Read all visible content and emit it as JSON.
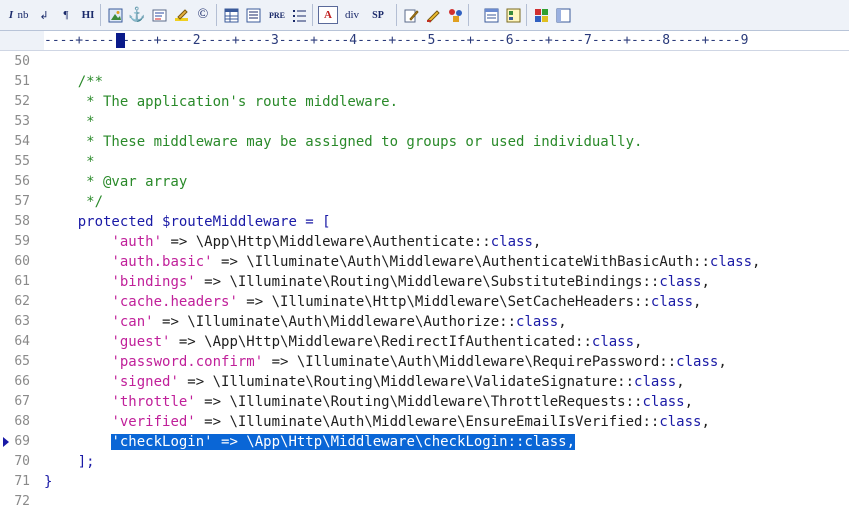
{
  "toolbar": {
    "buttons": [
      {
        "name": "italic-button",
        "label": "I",
        "icon": "italic-icon"
      },
      {
        "name": "nonbreaking-button",
        "label": "nb",
        "icon": "nb-icon"
      },
      {
        "name": "line-break-button",
        "label": "↲",
        "icon": "line-break-icon"
      },
      {
        "name": "paragraph-button",
        "label": "¶",
        "icon": "paragraph-icon"
      },
      {
        "name": "heading-button",
        "label": "HI",
        "icon": "heading-icon"
      },
      {
        "name": "image-button",
        "label": "",
        "icon": "image-icon"
      },
      {
        "name": "anchor-button",
        "label": "⚓",
        "icon": "anchor-icon"
      },
      {
        "name": "link-button",
        "label": "",
        "icon": "link-icon"
      },
      {
        "name": "highlight-button",
        "label": "",
        "icon": "highlight-icon"
      },
      {
        "name": "copyright-button",
        "label": "©",
        "icon": "copyright-icon"
      },
      {
        "name": "table-button",
        "label": "",
        "icon": "table-icon"
      },
      {
        "name": "list-button",
        "label": "",
        "icon": "list-icon"
      },
      {
        "name": "pre-button",
        "label": "PRE",
        "icon": "pre-icon"
      },
      {
        "name": "ordered-list-button",
        "label": "",
        "icon": "ordered-list-icon"
      },
      {
        "name": "font-button",
        "label": "A",
        "icon": "font-icon"
      },
      {
        "name": "div-button",
        "label": "div",
        "icon": "div-icon"
      },
      {
        "name": "span-button",
        "label": "SP",
        "icon": "span-icon"
      },
      {
        "name": "edit-button",
        "label": "",
        "icon": "edit-icon"
      },
      {
        "name": "style-button",
        "label": "",
        "icon": "style-icon"
      },
      {
        "name": "tools-button",
        "label": "",
        "icon": "tools-icon"
      },
      {
        "name": "frame-button",
        "label": "",
        "icon": "frame-icon"
      },
      {
        "name": "form-button",
        "label": "",
        "icon": "form-icon"
      },
      {
        "name": "color-button",
        "label": "",
        "icon": "color-icon"
      },
      {
        "name": "window-button",
        "label": "",
        "icon": "window-icon"
      }
    ]
  },
  "ruler": {
    "text": "----+----1----+----2----+----3----+----4----+----5----+----6----+----7----+----8----+----9"
  },
  "editor": {
    "lines": [
      {
        "n": "50",
        "segments": []
      },
      {
        "n": "51",
        "segments": [
          {
            "t": "    /**",
            "c": "cm"
          }
        ]
      },
      {
        "n": "52",
        "segments": [
          {
            "t": "     * The application's route middleware.",
            "c": "cm"
          }
        ]
      },
      {
        "n": "53",
        "segments": [
          {
            "t": "     *",
            "c": "cm"
          }
        ]
      },
      {
        "n": "54",
        "segments": [
          {
            "t": "     * These middleware may be assigned to groups or used individually.",
            "c": "cm"
          }
        ]
      },
      {
        "n": "55",
        "segments": [
          {
            "t": "     *",
            "c": "cm"
          }
        ]
      },
      {
        "n": "56",
        "segments": [
          {
            "t": "     * @var array",
            "c": "cm"
          }
        ]
      },
      {
        "n": "57",
        "segments": [
          {
            "t": "     */",
            "c": "cm"
          }
        ]
      },
      {
        "n": "58",
        "segments": [
          {
            "t": "    ",
            "c": "ns"
          },
          {
            "t": "protected",
            "c": "kw"
          },
          {
            "t": " ",
            "c": "ns"
          },
          {
            "t": "$routeMiddleware",
            "c": "kw"
          },
          {
            "t": " = [",
            "c": "kw"
          }
        ]
      },
      {
        "n": "59",
        "segments": [
          {
            "t": "        ",
            "c": "ns"
          },
          {
            "t": "'auth'",
            "c": "str"
          },
          {
            "t": " => \\App\\Http\\Middleware\\Authenticate::",
            "c": "ns"
          },
          {
            "t": "class",
            "c": "kw"
          },
          {
            "t": ",",
            "c": "ns"
          }
        ]
      },
      {
        "n": "60",
        "segments": [
          {
            "t": "        ",
            "c": "ns"
          },
          {
            "t": "'auth.basic'",
            "c": "str"
          },
          {
            "t": " => \\Illuminate\\Auth\\Middleware\\AuthenticateWithBasicAuth::",
            "c": "ns"
          },
          {
            "t": "class",
            "c": "kw"
          },
          {
            "t": ",",
            "c": "ns"
          }
        ]
      },
      {
        "n": "61",
        "segments": [
          {
            "t": "        ",
            "c": "ns"
          },
          {
            "t": "'bindings'",
            "c": "str"
          },
          {
            "t": " => \\Illuminate\\Routing\\Middleware\\SubstituteBindings::",
            "c": "ns"
          },
          {
            "t": "class",
            "c": "kw"
          },
          {
            "t": ",",
            "c": "ns"
          }
        ]
      },
      {
        "n": "62",
        "segments": [
          {
            "t": "        ",
            "c": "ns"
          },
          {
            "t": "'cache.headers'",
            "c": "str"
          },
          {
            "t": " => \\Illuminate\\Http\\Middleware\\SetCacheHeaders::",
            "c": "ns"
          },
          {
            "t": "class",
            "c": "kw"
          },
          {
            "t": ",",
            "c": "ns"
          }
        ]
      },
      {
        "n": "63",
        "segments": [
          {
            "t": "        ",
            "c": "ns"
          },
          {
            "t": "'can'",
            "c": "str"
          },
          {
            "t": " => \\Illuminate\\Auth\\Middleware\\Authorize::",
            "c": "ns"
          },
          {
            "t": "class",
            "c": "kw"
          },
          {
            "t": ",",
            "c": "ns"
          }
        ]
      },
      {
        "n": "64",
        "segments": [
          {
            "t": "        ",
            "c": "ns"
          },
          {
            "t": "'guest'",
            "c": "str"
          },
          {
            "t": " => \\App\\Http\\Middleware\\RedirectIfAuthenticated::",
            "c": "ns"
          },
          {
            "t": "class",
            "c": "kw"
          },
          {
            "t": ",",
            "c": "ns"
          }
        ]
      },
      {
        "n": "65",
        "segments": [
          {
            "t": "        ",
            "c": "ns"
          },
          {
            "t": "'password.confirm'",
            "c": "str"
          },
          {
            "t": " => \\Illuminate\\Auth\\Middleware\\RequirePassword::",
            "c": "ns"
          },
          {
            "t": "class",
            "c": "kw"
          },
          {
            "t": ",",
            "c": "ns"
          }
        ]
      },
      {
        "n": "66",
        "segments": [
          {
            "t": "        ",
            "c": "ns"
          },
          {
            "t": "'signed'",
            "c": "str"
          },
          {
            "t": " => \\Illuminate\\Routing\\Middleware\\ValidateSignature::",
            "c": "ns"
          },
          {
            "t": "class",
            "c": "kw"
          },
          {
            "t": ",",
            "c": "ns"
          }
        ]
      },
      {
        "n": "67",
        "segments": [
          {
            "t": "        ",
            "c": "ns"
          },
          {
            "t": "'throttle'",
            "c": "str"
          },
          {
            "t": " => \\Illuminate\\Routing\\Middleware\\ThrottleRequests::",
            "c": "ns"
          },
          {
            "t": "class",
            "c": "kw"
          },
          {
            "t": ",",
            "c": "ns"
          }
        ]
      },
      {
        "n": "68",
        "segments": [
          {
            "t": "        ",
            "c": "ns"
          },
          {
            "t": "'verified'",
            "c": "str"
          },
          {
            "t": " => \\Illuminate\\Auth\\Middleware\\EnsureEmailIsVerified::",
            "c": "ns"
          },
          {
            "t": "class",
            "c": "kw"
          },
          {
            "t": ",",
            "c": "ns"
          }
        ]
      },
      {
        "n": "69",
        "selected": true,
        "segments": [
          {
            "t": "        ",
            "c": "ns"
          },
          {
            "t": "'checkLogin' => \\App\\Http\\Middleware\\checkLogin::class,",
            "c": "sel"
          }
        ]
      },
      {
        "n": "70",
        "segments": [
          {
            "t": "    ];",
            "c": "kw"
          }
        ]
      },
      {
        "n": "71",
        "segments": [
          {
            "t": "}",
            "c": "kw"
          }
        ]
      },
      {
        "n": "72",
        "segments": []
      }
    ]
  },
  "colors": {
    "comment": "#2a8a2a",
    "keyword": "#1a1aa6",
    "string": "#c0209a",
    "selection": "#0a66d6"
  }
}
